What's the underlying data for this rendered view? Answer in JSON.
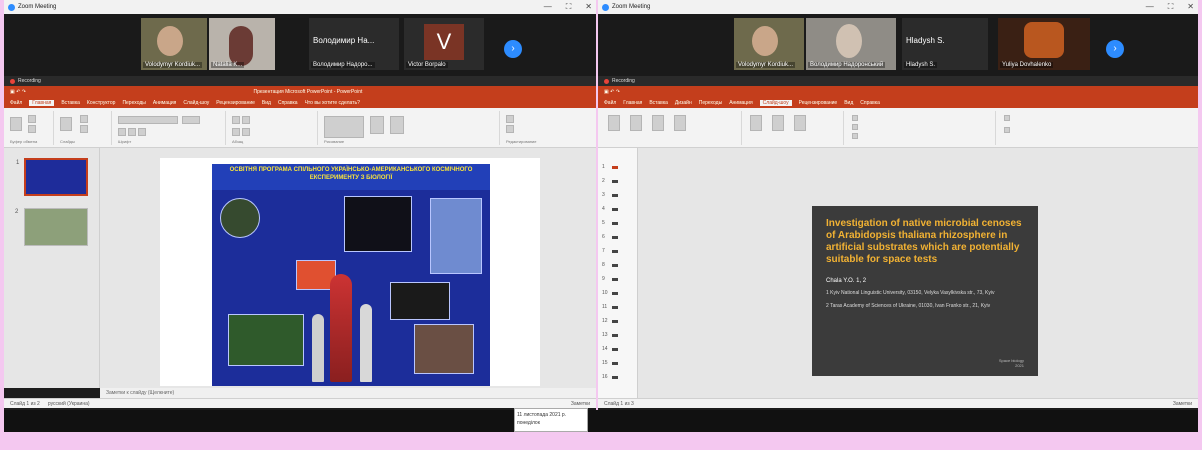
{
  "left": {
    "window_title": "Zoom Meeting",
    "participants": [
      {
        "name": "Volodymyr Kordiuk..."
      },
      {
        "name": "Natalia K..."
      },
      {
        "big": "Володимир На...",
        "name": "Володимир Надоро..."
      },
      {
        "avatar_letter": "V",
        "name": "Victor Borpalo"
      }
    ],
    "recording": "Recording",
    "ppt_title": "Презентация Microsoft PowerPoint - PowerPoint",
    "tabs": [
      "Файл",
      "Главная",
      "Вставка",
      "Конструктор",
      "Переходы",
      "Анимация",
      "Слайд-шоу",
      "Рецензирование",
      "Вид",
      "Справка",
      "Что вы хотите сделать?"
    ],
    "ribbon_groups": [
      "Буфер обмена",
      "Слайды",
      "Шрифт",
      "Абзац",
      "Рисование",
      "Редактирование"
    ],
    "poster_banner": "Освітня програма спільного українсько-американського космічного експерименту з біології",
    "notes_placeholder": "Заметки к слайду (Щелкните)",
    "status_left": "Слайд 1 из 2",
    "status_lang": "русский (Украина)",
    "status_right": "Заметки"
  },
  "right": {
    "window_title": "Zoom Meeting",
    "participants": [
      {
        "name": "Volodymyr Kordiuk..."
      },
      {
        "name": "Володимир Надоронський"
      },
      {
        "big": "Hladysh S.",
        "name": "Hladysh S."
      },
      {
        "name": "Yuliya Dovhalenko"
      }
    ],
    "recording": "Recording",
    "tabs": [
      "Файл",
      "Главная",
      "Вставка",
      "Дизайн",
      "Переходы",
      "Анимация",
      "Слайд-шоу",
      "Рецензирование",
      "Вид",
      "Справка"
    ],
    "slide_title": "Investigation of native microbial cenoses of Arabidopsis thaliana rhizosphere in artificial substrates which are potentially suitable for space tests",
    "slide_authors": "Chala Y.O. 1, 2",
    "slide_aff1": "1 Kyiv National Linguistic University, 03150, Velyka Vasylkivska str., 73, Kyiv",
    "slide_aff2": "2 Taras Academy of Sciences of Ukraine, 01030, Ivan Franko str., 21, Kyiv",
    "slide_foot1": "Space biology",
    "slide_foot2": "2021",
    "status_left": "Слайд 1 из 3",
    "status_right": "Заметки"
  },
  "clock": {
    "line1": "11 листопада 2021 р.",
    "line2": "понеділок"
  }
}
